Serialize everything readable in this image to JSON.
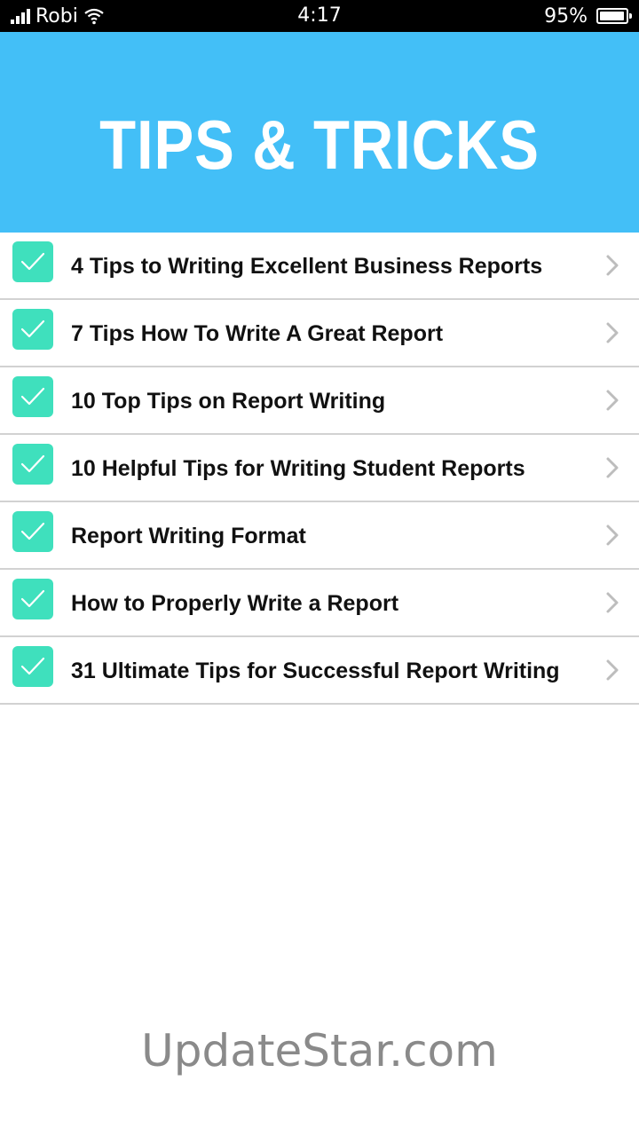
{
  "status_bar": {
    "carrier": "Robi",
    "time": "4:17",
    "battery": "95%",
    "battery_level": 0.95
  },
  "header": {
    "title": "TIPS & TRICKS",
    "background": "#43bff7"
  },
  "list": {
    "items": [
      {
        "label": "4 Tips to Writing Excellent Business Reports",
        "checked": true
      },
      {
        "label": "7 Tips How To Write A Great Report",
        "checked": true
      },
      {
        "label": "10 Top Tips on Report Writing",
        "checked": true
      },
      {
        "label": "10 Helpful Tips for Writing Student Reports",
        "checked": true
      },
      {
        "label": "Report Writing Format",
        "checked": true
      },
      {
        "label": "How to Properly Write a Report",
        "checked": true
      },
      {
        "label": "31 Ultimate Tips for Successful Report Writing",
        "checked": true
      }
    ],
    "check_color": "#3fe0bd",
    "icons": {
      "check": "checkmark-icon",
      "chevron": "chevron-right-icon"
    }
  },
  "watermark": "UpdateStar.com"
}
